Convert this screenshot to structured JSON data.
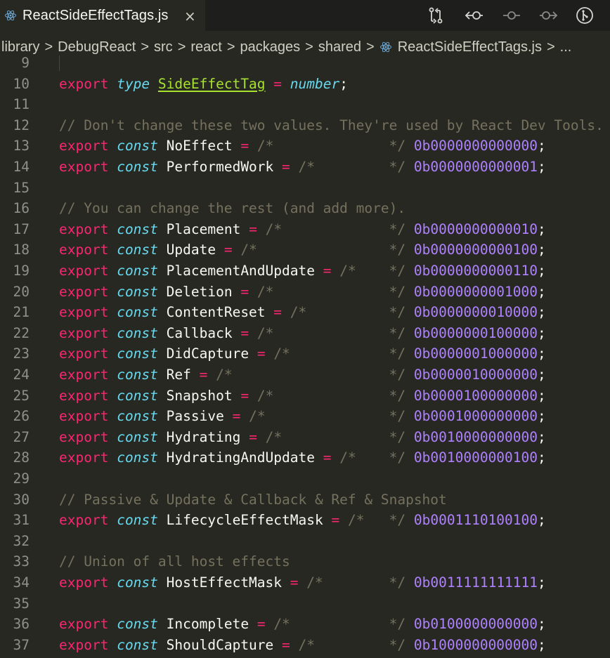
{
  "tab": {
    "title": "ReactSideEffectTags.js",
    "close": "×",
    "icon": "react-icon"
  },
  "toolbar": {
    "icons": [
      "compare-changes-icon",
      "go-previous-change-icon",
      "open-changes-icon",
      "go-next-change-icon",
      "git-lens-icon"
    ]
  },
  "breadcrumbs": [
    "library",
    "DebugReact",
    "src",
    "react",
    "packages",
    "shared",
    "ReactSideEffectTags.js",
    "..."
  ],
  "breadcrumb_separator": ">",
  "colors": {
    "background": "#272822",
    "keyword": "#f92672",
    "storage": "#66d9ef",
    "type": "#a6e22e",
    "comment": "#75715e",
    "number": "#ae81ff",
    "text": "#f8f8f2"
  },
  "lines": [
    {
      "n": "9",
      "tokens": []
    },
    {
      "n": "10",
      "tokens": [
        [
          "kw",
          "export"
        ],
        [
          "pc",
          " "
        ],
        [
          "st",
          "type"
        ],
        [
          "pc",
          " "
        ],
        [
          "ty",
          "SideEffectTag"
        ],
        [
          "pc",
          " "
        ],
        [
          "op",
          "="
        ],
        [
          "pc",
          " "
        ],
        [
          "st",
          "number"
        ],
        [
          "pc",
          ";"
        ]
      ]
    },
    {
      "n": "11",
      "tokens": []
    },
    {
      "n": "12",
      "tokens": [
        [
          "cm",
          "// Don't change these two values. They're used by React Dev Tools."
        ]
      ]
    },
    {
      "n": "13",
      "tokens": [
        [
          "kw",
          "export"
        ],
        [
          "pc",
          " "
        ],
        [
          "st",
          "const"
        ],
        [
          "pc",
          " "
        ],
        [
          "id",
          "NoEffect"
        ],
        [
          "pc",
          " "
        ],
        [
          "op",
          "="
        ],
        [
          "pc",
          " "
        ],
        [
          "cm",
          "/*              */"
        ],
        [
          "pc",
          " "
        ],
        [
          "nm",
          "0b0000000000000"
        ],
        [
          "pc",
          ";"
        ]
      ]
    },
    {
      "n": "14",
      "tokens": [
        [
          "kw",
          "export"
        ],
        [
          "pc",
          " "
        ],
        [
          "st",
          "const"
        ],
        [
          "pc",
          " "
        ],
        [
          "id",
          "PerformedWork"
        ],
        [
          "pc",
          " "
        ],
        [
          "op",
          "="
        ],
        [
          "pc",
          " "
        ],
        [
          "cm",
          "/*         */"
        ],
        [
          "pc",
          " "
        ],
        [
          "nm",
          "0b0000000000001"
        ],
        [
          "pc",
          ";"
        ]
      ]
    },
    {
      "n": "15",
      "tokens": []
    },
    {
      "n": "16",
      "tokens": [
        [
          "cm",
          "// You can change the rest (and add more)."
        ]
      ]
    },
    {
      "n": "17",
      "tokens": [
        [
          "kw",
          "export"
        ],
        [
          "pc",
          " "
        ],
        [
          "st",
          "const"
        ],
        [
          "pc",
          " "
        ],
        [
          "id",
          "Placement"
        ],
        [
          "pc",
          " "
        ],
        [
          "op",
          "="
        ],
        [
          "pc",
          " "
        ],
        [
          "cm",
          "/*             */"
        ],
        [
          "pc",
          " "
        ],
        [
          "nm",
          "0b0000000000010"
        ],
        [
          "pc",
          ";"
        ]
      ]
    },
    {
      "n": "18",
      "tokens": [
        [
          "kw",
          "export"
        ],
        [
          "pc",
          " "
        ],
        [
          "st",
          "const"
        ],
        [
          "pc",
          " "
        ],
        [
          "id",
          "Update"
        ],
        [
          "pc",
          " "
        ],
        [
          "op",
          "="
        ],
        [
          "pc",
          " "
        ],
        [
          "cm",
          "/*                */"
        ],
        [
          "pc",
          " "
        ],
        [
          "nm",
          "0b0000000000100"
        ],
        [
          "pc",
          ";"
        ]
      ]
    },
    {
      "n": "19",
      "tokens": [
        [
          "kw",
          "export"
        ],
        [
          "pc",
          " "
        ],
        [
          "st",
          "const"
        ],
        [
          "pc",
          " "
        ],
        [
          "id",
          "PlacementAndUpdate"
        ],
        [
          "pc",
          " "
        ],
        [
          "op",
          "="
        ],
        [
          "pc",
          " "
        ],
        [
          "cm",
          "/*    */"
        ],
        [
          "pc",
          " "
        ],
        [
          "nm",
          "0b0000000000110"
        ],
        [
          "pc",
          ";"
        ]
      ]
    },
    {
      "n": "20",
      "tokens": [
        [
          "kw",
          "export"
        ],
        [
          "pc",
          " "
        ],
        [
          "st",
          "const"
        ],
        [
          "pc",
          " "
        ],
        [
          "id",
          "Deletion"
        ],
        [
          "pc",
          " "
        ],
        [
          "op",
          "="
        ],
        [
          "pc",
          " "
        ],
        [
          "cm",
          "/*              */"
        ],
        [
          "pc",
          " "
        ],
        [
          "nm",
          "0b0000000001000"
        ],
        [
          "pc",
          ";"
        ]
      ]
    },
    {
      "n": "21",
      "tokens": [
        [
          "kw",
          "export"
        ],
        [
          "pc",
          " "
        ],
        [
          "st",
          "const"
        ],
        [
          "pc",
          " "
        ],
        [
          "id",
          "ContentReset"
        ],
        [
          "pc",
          " "
        ],
        [
          "op",
          "="
        ],
        [
          "pc",
          " "
        ],
        [
          "cm",
          "/*          */"
        ],
        [
          "pc",
          " "
        ],
        [
          "nm",
          "0b0000000010000"
        ],
        [
          "pc",
          ";"
        ]
      ]
    },
    {
      "n": "22",
      "tokens": [
        [
          "kw",
          "export"
        ],
        [
          "pc",
          " "
        ],
        [
          "st",
          "const"
        ],
        [
          "pc",
          " "
        ],
        [
          "id",
          "Callback"
        ],
        [
          "pc",
          " "
        ],
        [
          "op",
          "="
        ],
        [
          "pc",
          " "
        ],
        [
          "cm",
          "/*              */"
        ],
        [
          "pc",
          " "
        ],
        [
          "nm",
          "0b0000000100000"
        ],
        [
          "pc",
          ";"
        ]
      ]
    },
    {
      "n": "23",
      "tokens": [
        [
          "kw",
          "export"
        ],
        [
          "pc",
          " "
        ],
        [
          "st",
          "const"
        ],
        [
          "pc",
          " "
        ],
        [
          "id",
          "DidCapture"
        ],
        [
          "pc",
          " "
        ],
        [
          "op",
          "="
        ],
        [
          "pc",
          " "
        ],
        [
          "cm",
          "/*            */"
        ],
        [
          "pc",
          " "
        ],
        [
          "nm",
          "0b0000001000000"
        ],
        [
          "pc",
          ";"
        ]
      ]
    },
    {
      "n": "24",
      "tokens": [
        [
          "kw",
          "export"
        ],
        [
          "pc",
          " "
        ],
        [
          "st",
          "const"
        ],
        [
          "pc",
          " "
        ],
        [
          "id",
          "Ref"
        ],
        [
          "pc",
          " "
        ],
        [
          "op",
          "="
        ],
        [
          "pc",
          " "
        ],
        [
          "cm",
          "/*                   */"
        ],
        [
          "pc",
          " "
        ],
        [
          "nm",
          "0b0000010000000"
        ],
        [
          "pc",
          ";"
        ]
      ]
    },
    {
      "n": "25",
      "tokens": [
        [
          "kw",
          "export"
        ],
        [
          "pc",
          " "
        ],
        [
          "st",
          "const"
        ],
        [
          "pc",
          " "
        ],
        [
          "id",
          "Snapshot"
        ],
        [
          "pc",
          " "
        ],
        [
          "op",
          "="
        ],
        [
          "pc",
          " "
        ],
        [
          "cm",
          "/*              */"
        ],
        [
          "pc",
          " "
        ],
        [
          "nm",
          "0b0000100000000"
        ],
        [
          "pc",
          ";"
        ]
      ]
    },
    {
      "n": "26",
      "tokens": [
        [
          "kw",
          "export"
        ],
        [
          "pc",
          " "
        ],
        [
          "st",
          "const"
        ],
        [
          "pc",
          " "
        ],
        [
          "id",
          "Passive"
        ],
        [
          "pc",
          " "
        ],
        [
          "op",
          "="
        ],
        [
          "pc",
          " "
        ],
        [
          "cm",
          "/*               */"
        ],
        [
          "pc",
          " "
        ],
        [
          "nm",
          "0b0001000000000"
        ],
        [
          "pc",
          ";"
        ]
      ]
    },
    {
      "n": "27",
      "tokens": [
        [
          "kw",
          "export"
        ],
        [
          "pc",
          " "
        ],
        [
          "st",
          "const"
        ],
        [
          "pc",
          " "
        ],
        [
          "id",
          "Hydrating"
        ],
        [
          "pc",
          " "
        ],
        [
          "op",
          "="
        ],
        [
          "pc",
          " "
        ],
        [
          "cm",
          "/*             */"
        ],
        [
          "pc",
          " "
        ],
        [
          "nm",
          "0b0010000000000"
        ],
        [
          "pc",
          ";"
        ]
      ]
    },
    {
      "n": "28",
      "tokens": [
        [
          "kw",
          "export"
        ],
        [
          "pc",
          " "
        ],
        [
          "st",
          "const"
        ],
        [
          "pc",
          " "
        ],
        [
          "id",
          "HydratingAndUpdate"
        ],
        [
          "pc",
          " "
        ],
        [
          "op",
          "="
        ],
        [
          "pc",
          " "
        ],
        [
          "cm",
          "/*    */"
        ],
        [
          "pc",
          " "
        ],
        [
          "nm",
          "0b0010000000100"
        ],
        [
          "pc",
          ";"
        ]
      ]
    },
    {
      "n": "29",
      "tokens": []
    },
    {
      "n": "30",
      "tokens": [
        [
          "cm",
          "// Passive & Update & Callback & Ref & Snapshot"
        ]
      ]
    },
    {
      "n": "31",
      "tokens": [
        [
          "kw",
          "export"
        ],
        [
          "pc",
          " "
        ],
        [
          "st",
          "const"
        ],
        [
          "pc",
          " "
        ],
        [
          "id",
          "LifecycleEffectMask"
        ],
        [
          "pc",
          " "
        ],
        [
          "op",
          "="
        ],
        [
          "pc",
          " "
        ],
        [
          "cm",
          "/*   */"
        ],
        [
          "pc",
          " "
        ],
        [
          "nm",
          "0b0001110100100"
        ],
        [
          "pc",
          ";"
        ]
      ]
    },
    {
      "n": "32",
      "tokens": []
    },
    {
      "n": "33",
      "tokens": [
        [
          "cm",
          "// Union of all host effects"
        ]
      ]
    },
    {
      "n": "34",
      "tokens": [
        [
          "kw",
          "export"
        ],
        [
          "pc",
          " "
        ],
        [
          "st",
          "const"
        ],
        [
          "pc",
          " "
        ],
        [
          "id",
          "HostEffectMask"
        ],
        [
          "pc",
          " "
        ],
        [
          "op",
          "="
        ],
        [
          "pc",
          " "
        ],
        [
          "cm",
          "/*        */"
        ],
        [
          "pc",
          " "
        ],
        [
          "nm",
          "0b0011111111111"
        ],
        [
          "pc",
          ";"
        ]
      ]
    },
    {
      "n": "35",
      "tokens": []
    },
    {
      "n": "36",
      "tokens": [
        [
          "kw",
          "export"
        ],
        [
          "pc",
          " "
        ],
        [
          "st",
          "const"
        ],
        [
          "pc",
          " "
        ],
        [
          "id",
          "Incomplete"
        ],
        [
          "pc",
          " "
        ],
        [
          "op",
          "="
        ],
        [
          "pc",
          " "
        ],
        [
          "cm",
          "/*            */"
        ],
        [
          "pc",
          " "
        ],
        [
          "nm",
          "0b0100000000000"
        ],
        [
          "pc",
          ";"
        ]
      ]
    },
    {
      "n": "37",
      "tokens": [
        [
          "kw",
          "export"
        ],
        [
          "pc",
          " "
        ],
        [
          "st",
          "const"
        ],
        [
          "pc",
          " "
        ],
        [
          "id",
          "ShouldCapture"
        ],
        [
          "pc",
          " "
        ],
        [
          "op",
          "="
        ],
        [
          "pc",
          " "
        ],
        [
          "cm",
          "/*         */"
        ],
        [
          "pc",
          " "
        ],
        [
          "nm",
          "0b1000000000000"
        ],
        [
          "pc",
          ";"
        ]
      ]
    }
  ]
}
